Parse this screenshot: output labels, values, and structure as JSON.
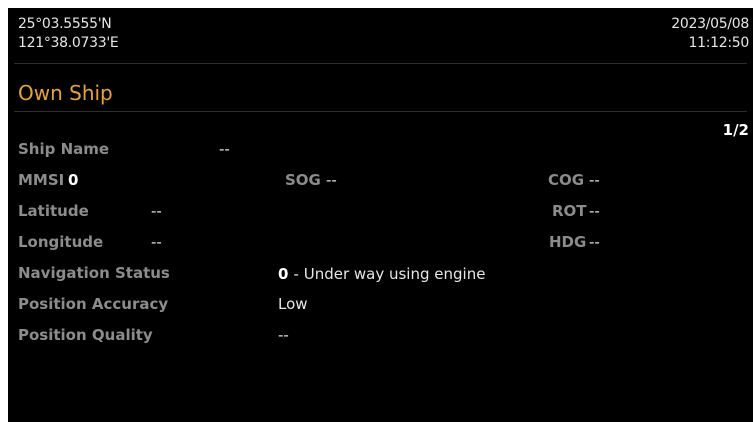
{
  "header": {
    "latitude": "25°03.5555'N",
    "longitude": "121°38.0733'E",
    "date": "2023/05/08",
    "time": "11:12:50"
  },
  "title": "Own Ship",
  "page_indicator": "1/2",
  "fields": {
    "ship_name": {
      "label": "Ship Name",
      "value": "--"
    },
    "mmsi": {
      "label": "MMSI",
      "value": "0"
    },
    "sog": {
      "label": "SOG",
      "value": "--"
    },
    "cog": {
      "label": "COG",
      "value": "--"
    },
    "latitude": {
      "label": "Latitude",
      "value": "--"
    },
    "rot": {
      "label": "ROT",
      "value": "--"
    },
    "longitude": {
      "label": "Longitude",
      "value": "--"
    },
    "hdg": {
      "label": "HDG",
      "value": "--"
    },
    "navigation_status": {
      "label": "Navigation Status",
      "code": "0",
      "value": "- Under way using engine"
    },
    "position_accuracy": {
      "label": "Position Accuracy",
      "value": "Low"
    },
    "position_quality": {
      "label": "Position Quality",
      "value": "--"
    }
  },
  "colors": {
    "background": "#000000",
    "title": "#e8a23a",
    "label": "#8c8c8c",
    "value": "#e6e6e6"
  }
}
